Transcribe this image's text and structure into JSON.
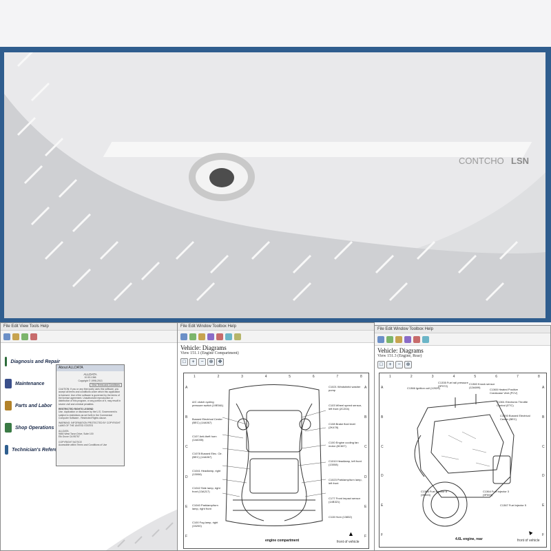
{
  "splash": {
    "text_right": "LSN",
    "text_mid": "CONTCHO"
  },
  "left_window": {
    "menubar": "File  Edit  View  Tools  Help",
    "nav_items": [
      {
        "label": "Diagnosis and Repair",
        "icon": "wrench-book-icon",
        "color": "#2d6b3a"
      },
      {
        "label": "Maintenance",
        "icon": "calendar-icon",
        "color": "#3a4f8a"
      },
      {
        "label": "Parts and Labor",
        "icon": "gear-icon",
        "color": "#b2822a"
      },
      {
        "label": "Shop Operations",
        "icon": "building-icon",
        "color": "#3a7a44"
      },
      {
        "label": "Technician's Referen",
        "icon": "reference-book-icon",
        "color": "#2f5f8f"
      }
    ],
    "about": {
      "title": "About ALLDATA",
      "product": "ALLDATA",
      "version": "10.53.1366",
      "copyright": "Copyright © 1998-2013",
      "button": "View Terms and Conditions",
      "body": "CAUTION: If you or any third party uses this software, you accept all terms and conditions under which this application is licensed. Use of the software is governed by the terms of the license agreement. Unauthorized reproduction or distribution of this program, or any portion of it, may result in severe civil and criminal penalties.",
      "notice_heading": "RESTRICTED RIGHTS LEGEND",
      "notice": "Use, duplication or disclosure by the U.S. Government is subject to restrictions as set forth in the Commercial Computer Software - Restricted Rights clause.",
      "warning": "WARNING: INFORMATION PROTECTED BY COPYRIGHT LAWS OF THE UNITED STATES",
      "company": "ALLDATA",
      "address_1": "9650 West Taron Drive, Suite 100",
      "address_2": "Elk Grove CA 95757",
      "copyright_notice": "COPYRIGHT NOTICE",
      "trademark": "Accessible within Terms and Conditions of Use"
    }
  },
  "middle_window": {
    "menubar": "File  Edit  Window  Toolbox  Help",
    "title": "Vehicle: Diagrams",
    "view": "View 151.1 (Engine Compartment)",
    "caption": "engine compartment",
    "front_label": "front of vehicle",
    "col_labels": [
      "1",
      "2",
      "3",
      "4",
      "5",
      "6",
      "7",
      "8"
    ],
    "row_labels": [
      "A",
      "B",
      "C",
      "D",
      "E",
      "F"
    ],
    "callouts_left": [
      "A/C clutch cycling pressure switch (19E561)",
      "Bussed Electrical Center (BEC) (14A067)",
      "C107 Anti-theft horn (14A035)",
      "C1078 Bussed Elec. Ctr. (BEC) (14A067)",
      "C1041 Headlamp, right (13008)",
      "C1042 Side lamp, right front (13A217)",
      "C1040 Parklamp/turn lamp, right front",
      "C100 Fog lamp, right (15200)"
    ],
    "callouts_right": [
      "C1021 Windshield washer pump",
      "C103 Wheel speed sensor, left front (2C204)",
      "C108 Brake fluid level (2K478)",
      "C100 Engine cooling fan motor (8C607)",
      "C1010 Headlamp, left front (13008)",
      "C1023 Parklamp/turn lamp, left front",
      "C177 Front impact sensor (14B321)",
      "C115 Horn (13832)"
    ]
  },
  "right_window": {
    "menubar": "File  Edit  Window  Toolbox  Help",
    "title": "Vehicle: Diagrams",
    "view": "View 151.3 (Engine, Rear)",
    "caption": "4.6L engine, rear",
    "front_label": "front of vehicle",
    "callouts": [
      "C1366 Ignition coil (12029)",
      "C1335 Fuel rail pressure (9F972)",
      "C1360 Knock sensor (12A699)",
      "C1365 Heated Positive Crankcase Vent (PCV)",
      "C1361 Electronic Throttle Control (ETC)",
      "C1000 Bussed Electrical Center (BEC)",
      "C1366 Fuel injector 8 (9F593)",
      "C1364 Fuel injector 3 (9F593)",
      "C1367 Fuel injector 5"
    ]
  },
  "colors": {
    "splash_border": "#2f5d8e",
    "nav_text": "#1a2a4a",
    "diagram_line": "#222222"
  }
}
